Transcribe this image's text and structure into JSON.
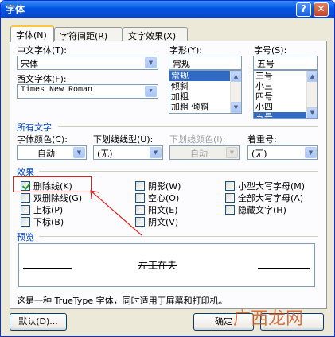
{
  "window": {
    "title": "字体",
    "help_label": "?",
    "close_label": "✕"
  },
  "tabs": [
    {
      "label": "字体(N)"
    },
    {
      "label": "字符间距(R)"
    },
    {
      "label": "文字效果(X)"
    }
  ],
  "font": {
    "chinese_label": "中文字体(T):",
    "chinese_value": "宋体",
    "western_label": "西文字体(F):",
    "western_value": "Times New Roman",
    "style_label": "字形(Y):",
    "style_value": "常规",
    "style_options": [
      "常规",
      "倾斜",
      "加粗",
      "加粗 倾斜"
    ],
    "size_label": "字号(S):",
    "size_value": "五号",
    "size_options": [
      "三号",
      "小三",
      "四号",
      "小四",
      "五号"
    ]
  },
  "all_text": {
    "section_label": "所有文字",
    "color_label": "字体颜色(C):",
    "color_value": "自动",
    "underline_label": "下划线线型(U):",
    "underline_value": "(无)",
    "underline_color_label": "下划线颜色(I):",
    "underline_color_value": "自动",
    "emphasis_label": "着重号:",
    "emphasis_value": "(无)"
  },
  "effects": {
    "section_label": "效果",
    "items": [
      {
        "label": "删除线(K)",
        "checked": true
      },
      {
        "label": "双删除线(G)",
        "checked": false
      },
      {
        "label": "上标(P)",
        "checked": false
      },
      {
        "label": "下标(B)",
        "checked": false
      },
      {
        "label": "阴影(W)",
        "checked": false
      },
      {
        "label": "空心(O)",
        "checked": false
      },
      {
        "label": "阳文(E)",
        "checked": false
      },
      {
        "label": "阴文(V)",
        "checked": false
      },
      {
        "label": "小型大写字母(M)",
        "checked": false
      },
      {
        "label": "全部大写字母(A)",
        "checked": false
      },
      {
        "label": "隐藏文字(H)",
        "checked": false
      }
    ]
  },
  "preview": {
    "section_label": "预览",
    "sample_text": "左工在夫"
  },
  "note": "这是一种 TrueType 字体，同时适用于屏幕和打印机。",
  "buttons": {
    "default_label": "默认(D)...",
    "ok_label": "确定"
  },
  "watermark": "广西龙网",
  "colors": {
    "title_bar": "#0054e3",
    "section_label": "#0046d5",
    "selection": "#316ac5",
    "annotation": "#e02020"
  }
}
